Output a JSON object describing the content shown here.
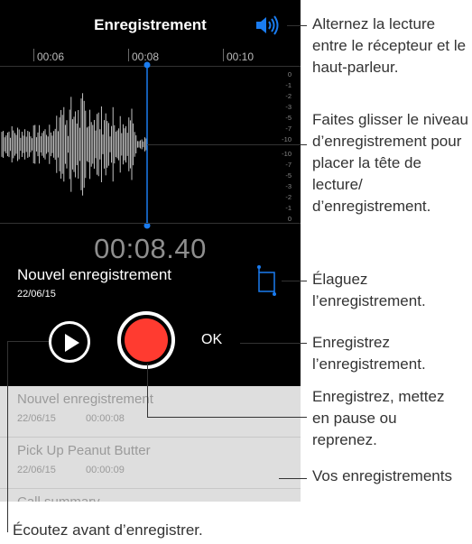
{
  "screen": {
    "title": "Enregistrement",
    "timeline_labels": [
      "00:06",
      "00:08",
      "00:10"
    ],
    "db_labels_top": [
      "0",
      "-1",
      "-2",
      "-3",
      "-5",
      "-7",
      "-10"
    ],
    "db_labels_bottom": [
      "-10",
      "-7",
      "-5",
      "-3",
      "-2",
      "-1",
      "0"
    ],
    "elapsed_time": "00:08.40",
    "recording_name": "Nouvel enregistrement",
    "recording_date": "22/06/15",
    "ok_label": "OK",
    "colors": {
      "record": "#ff3b30",
      "accent": "#1a7cf0"
    },
    "icons": [
      "speaker-icon",
      "trim-icon",
      "play-icon",
      "record-icon"
    ]
  },
  "list": {
    "items": [
      {
        "title": "Nouvel enregistrement",
        "date": "22/06/15",
        "duration": "00:00:08"
      },
      {
        "title": "Pick Up Peanut Butter",
        "date": "22/06/15",
        "duration": "00:00:09"
      },
      {
        "title": "Call summary",
        "date": "",
        "duration": ""
      }
    ]
  },
  "callouts": {
    "speaker": "Alternez la lecture entre le récepteur et le haut-parleur.",
    "drag": "Faites glisser le niveau d’enregistrement pour placer la tête de lecture/ d’enregistrement.",
    "trim": "Élaguez l’enregistrement.",
    "save": "Enregistrez l’enregistrement.",
    "record": "Enregistrez, mettez en pause ou reprenez.",
    "recordings": "Vos enregistrements",
    "listen": "Écoutez avant d’enregistrer."
  }
}
